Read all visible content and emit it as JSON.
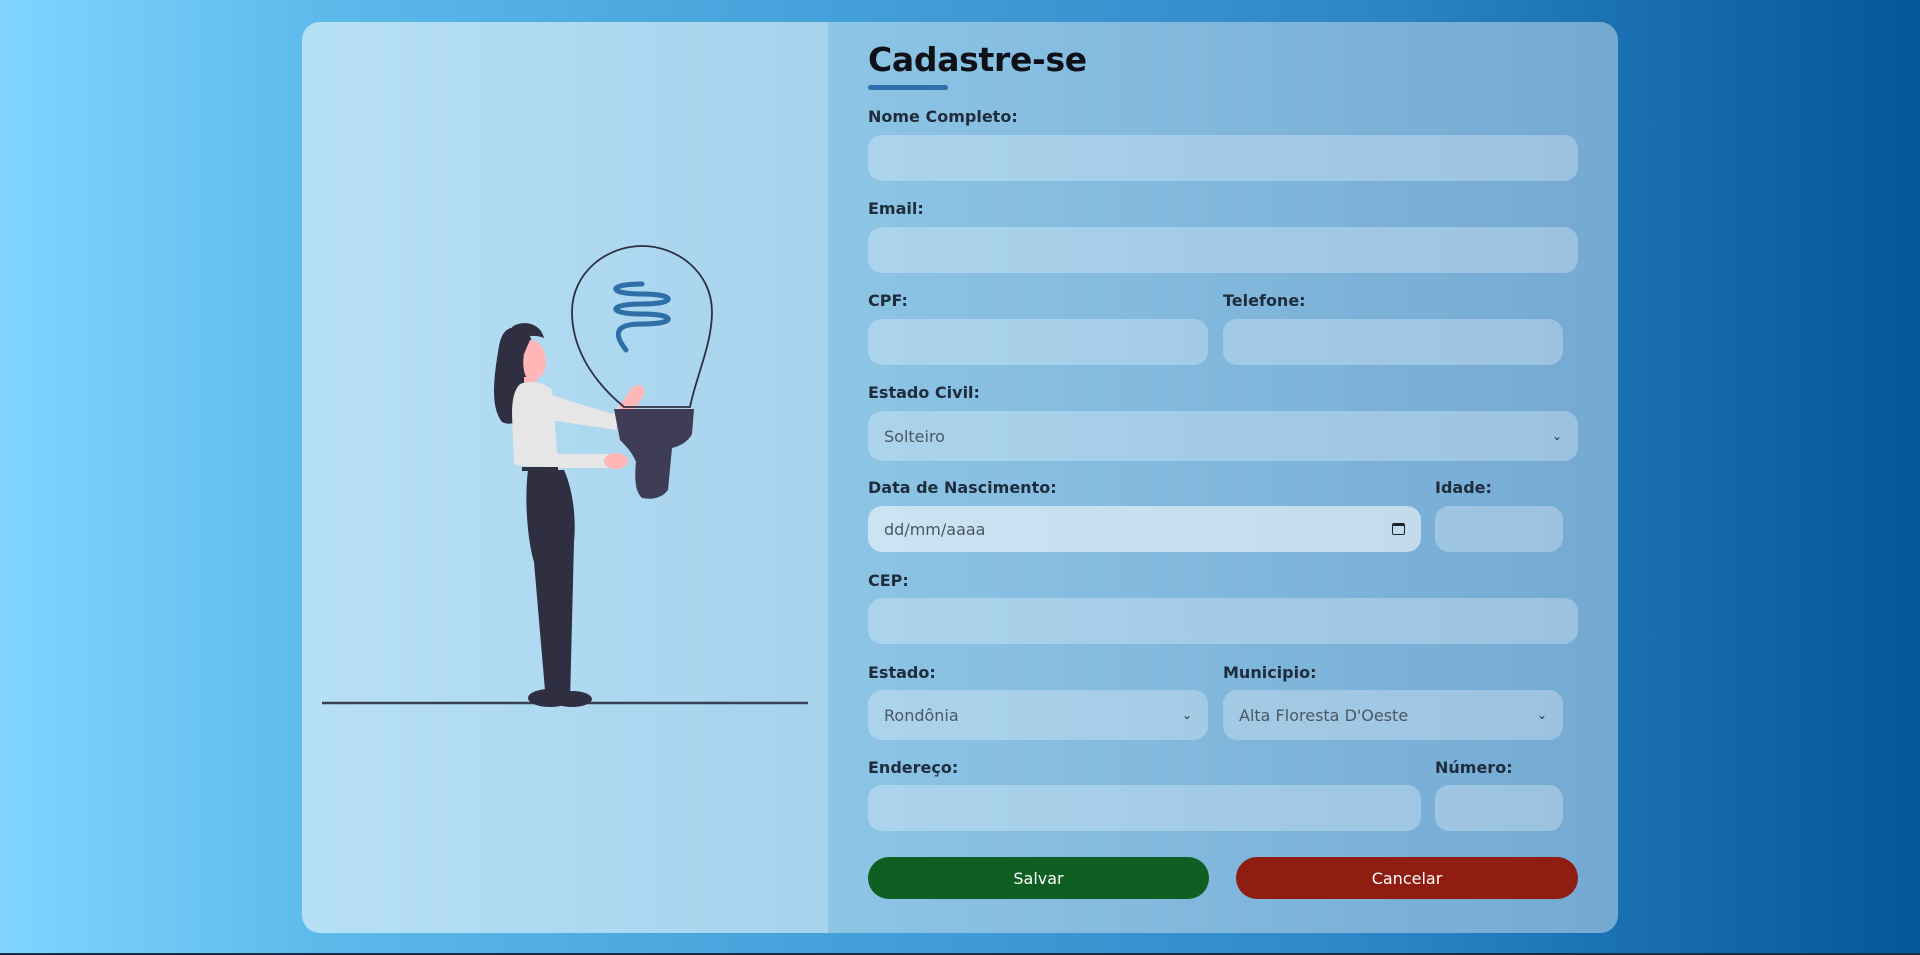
{
  "form": {
    "title": "Cadastre-se",
    "fields": {
      "nome": {
        "label": "Nome Completo:",
        "value": ""
      },
      "email": {
        "label": "Email:",
        "value": ""
      },
      "cpf": {
        "label": "CPF:",
        "value": ""
      },
      "telefone": {
        "label": "Telefone:",
        "value": ""
      },
      "estado_civil": {
        "label": "Estado Civil:",
        "value": "Solteiro"
      },
      "data_nascimento": {
        "label": "Data de Nascimento:",
        "placeholder": "dd/mm/aaaa"
      },
      "idade": {
        "label": "Idade:",
        "value": ""
      },
      "cep": {
        "label": "CEP:",
        "value": ""
      },
      "estado": {
        "label": "Estado:",
        "value": "Rondônia"
      },
      "municipio": {
        "label": "Municipio:",
        "value": "Alta Floresta D'Oeste"
      },
      "endereco": {
        "label": "Endereço:",
        "value": ""
      },
      "numero": {
        "label": "Número:",
        "value": ""
      }
    },
    "buttons": {
      "save": "Salvar",
      "cancel": "Cancelar"
    }
  },
  "colors": {
    "save_button": "#0f5e22",
    "cancel_button": "#8f1d12",
    "accent": "#2c6fac"
  },
  "illustration": {
    "icon": "woman-holding-lightbulb"
  }
}
